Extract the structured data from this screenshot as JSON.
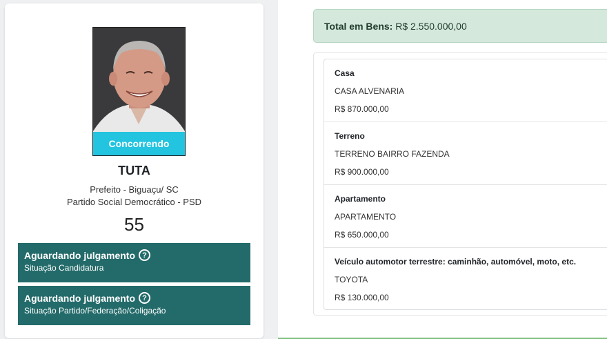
{
  "candidate": {
    "status_badge": "Concorrendo",
    "name": "TUTA",
    "office": "Prefeito - Biguaçu/ SC",
    "party": "Partido Social Democrático - PSD",
    "number": "55",
    "situations": [
      {
        "title": "Aguardando julgamento",
        "subtitle": "Situação Candidatura"
      },
      {
        "title": "Aguardando julgamento",
        "subtitle": "Situação Partido/Federação/Coligação"
      }
    ]
  },
  "bens": {
    "total_label": "Total em Bens:",
    "total_value": "R$ 2.550.000,00",
    "items": [
      {
        "type": "Casa",
        "description": "CASA ALVENARIA",
        "value": "R$ 870.000,00"
      },
      {
        "type": "Terreno",
        "description": "TERRENO BAIRRO FAZENDA",
        "value": "R$ 900.000,00"
      },
      {
        "type": "Apartamento",
        "description": "APARTAMENTO",
        "value": "R$ 650.000,00"
      },
      {
        "type": "Veículo automotor terrestre: caminhão, automóvel, moto, etc.",
        "description": "TOYOTA",
        "value": "R$ 130.000,00"
      }
    ]
  },
  "colors": {
    "badge": "#22c4e0",
    "situation_bg": "#236b6a",
    "total_alert_bg": "#d4e8dc"
  },
  "icons": {
    "help": "question-circle-icon"
  }
}
